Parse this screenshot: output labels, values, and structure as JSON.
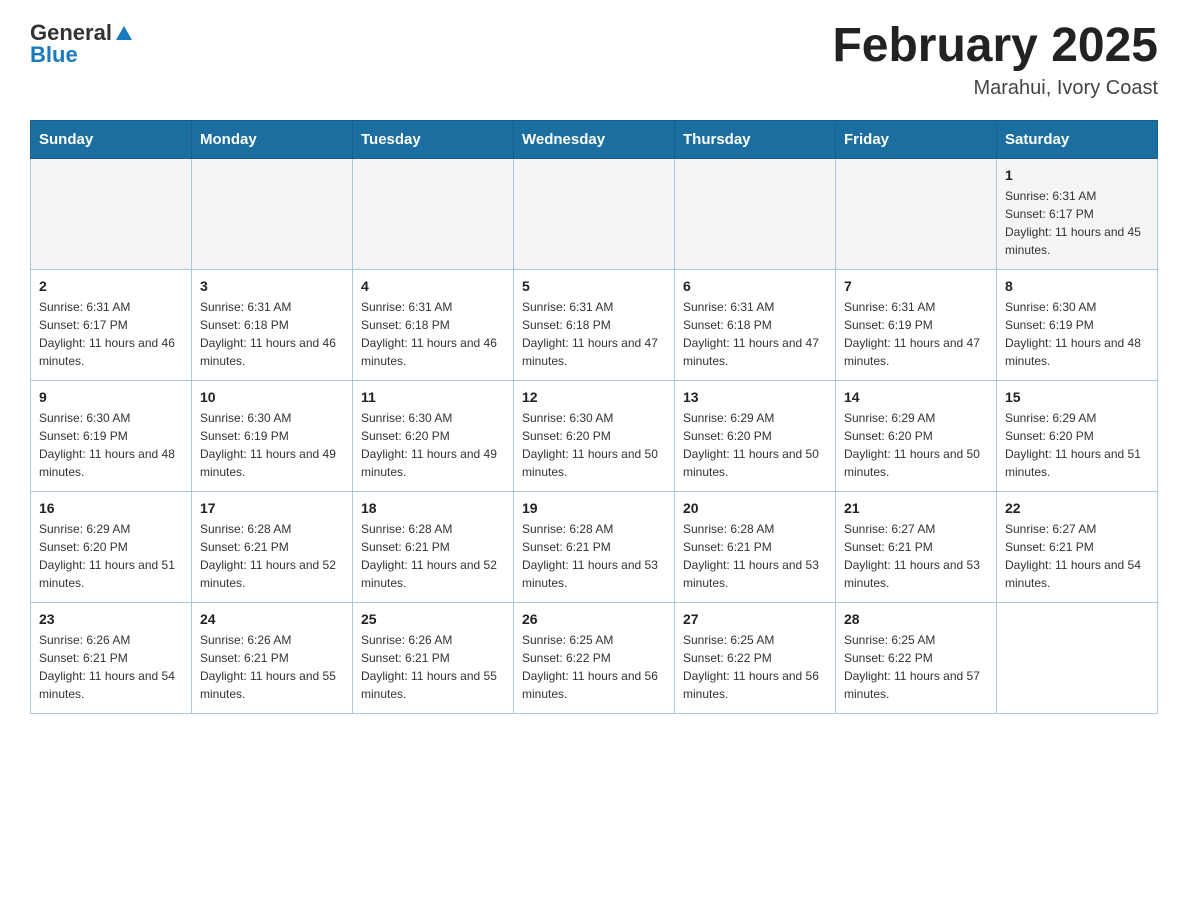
{
  "logo": {
    "general": "General",
    "blue": "Blue"
  },
  "title": "February 2025",
  "location": "Marahui, Ivory Coast",
  "weekdays": [
    "Sunday",
    "Monday",
    "Tuesday",
    "Wednesday",
    "Thursday",
    "Friday",
    "Saturday"
  ],
  "weeks": [
    {
      "days": [
        {
          "num": "",
          "info": ""
        },
        {
          "num": "",
          "info": ""
        },
        {
          "num": "",
          "info": ""
        },
        {
          "num": "",
          "info": ""
        },
        {
          "num": "",
          "info": ""
        },
        {
          "num": "",
          "info": ""
        },
        {
          "num": "1",
          "info": "Sunrise: 6:31 AM\nSunset: 6:17 PM\nDaylight: 11 hours and 45 minutes."
        }
      ]
    },
    {
      "days": [
        {
          "num": "2",
          "info": "Sunrise: 6:31 AM\nSunset: 6:17 PM\nDaylight: 11 hours and 46 minutes."
        },
        {
          "num": "3",
          "info": "Sunrise: 6:31 AM\nSunset: 6:18 PM\nDaylight: 11 hours and 46 minutes."
        },
        {
          "num": "4",
          "info": "Sunrise: 6:31 AM\nSunset: 6:18 PM\nDaylight: 11 hours and 46 minutes."
        },
        {
          "num": "5",
          "info": "Sunrise: 6:31 AM\nSunset: 6:18 PM\nDaylight: 11 hours and 47 minutes."
        },
        {
          "num": "6",
          "info": "Sunrise: 6:31 AM\nSunset: 6:18 PM\nDaylight: 11 hours and 47 minutes."
        },
        {
          "num": "7",
          "info": "Sunrise: 6:31 AM\nSunset: 6:19 PM\nDaylight: 11 hours and 47 minutes."
        },
        {
          "num": "8",
          "info": "Sunrise: 6:30 AM\nSunset: 6:19 PM\nDaylight: 11 hours and 48 minutes."
        }
      ]
    },
    {
      "days": [
        {
          "num": "9",
          "info": "Sunrise: 6:30 AM\nSunset: 6:19 PM\nDaylight: 11 hours and 48 minutes."
        },
        {
          "num": "10",
          "info": "Sunrise: 6:30 AM\nSunset: 6:19 PM\nDaylight: 11 hours and 49 minutes."
        },
        {
          "num": "11",
          "info": "Sunrise: 6:30 AM\nSunset: 6:20 PM\nDaylight: 11 hours and 49 minutes."
        },
        {
          "num": "12",
          "info": "Sunrise: 6:30 AM\nSunset: 6:20 PM\nDaylight: 11 hours and 50 minutes."
        },
        {
          "num": "13",
          "info": "Sunrise: 6:29 AM\nSunset: 6:20 PM\nDaylight: 11 hours and 50 minutes."
        },
        {
          "num": "14",
          "info": "Sunrise: 6:29 AM\nSunset: 6:20 PM\nDaylight: 11 hours and 50 minutes."
        },
        {
          "num": "15",
          "info": "Sunrise: 6:29 AM\nSunset: 6:20 PM\nDaylight: 11 hours and 51 minutes."
        }
      ]
    },
    {
      "days": [
        {
          "num": "16",
          "info": "Sunrise: 6:29 AM\nSunset: 6:20 PM\nDaylight: 11 hours and 51 minutes."
        },
        {
          "num": "17",
          "info": "Sunrise: 6:28 AM\nSunset: 6:21 PM\nDaylight: 11 hours and 52 minutes."
        },
        {
          "num": "18",
          "info": "Sunrise: 6:28 AM\nSunset: 6:21 PM\nDaylight: 11 hours and 52 minutes."
        },
        {
          "num": "19",
          "info": "Sunrise: 6:28 AM\nSunset: 6:21 PM\nDaylight: 11 hours and 53 minutes."
        },
        {
          "num": "20",
          "info": "Sunrise: 6:28 AM\nSunset: 6:21 PM\nDaylight: 11 hours and 53 minutes."
        },
        {
          "num": "21",
          "info": "Sunrise: 6:27 AM\nSunset: 6:21 PM\nDaylight: 11 hours and 53 minutes."
        },
        {
          "num": "22",
          "info": "Sunrise: 6:27 AM\nSunset: 6:21 PM\nDaylight: 11 hours and 54 minutes."
        }
      ]
    },
    {
      "days": [
        {
          "num": "23",
          "info": "Sunrise: 6:26 AM\nSunset: 6:21 PM\nDaylight: 11 hours and 54 minutes."
        },
        {
          "num": "24",
          "info": "Sunrise: 6:26 AM\nSunset: 6:21 PM\nDaylight: 11 hours and 55 minutes."
        },
        {
          "num": "25",
          "info": "Sunrise: 6:26 AM\nSunset: 6:21 PM\nDaylight: 11 hours and 55 minutes."
        },
        {
          "num": "26",
          "info": "Sunrise: 6:25 AM\nSunset: 6:22 PM\nDaylight: 11 hours and 56 minutes."
        },
        {
          "num": "27",
          "info": "Sunrise: 6:25 AM\nSunset: 6:22 PM\nDaylight: 11 hours and 56 minutes."
        },
        {
          "num": "28",
          "info": "Sunrise: 6:25 AM\nSunset: 6:22 PM\nDaylight: 11 hours and 57 minutes."
        },
        {
          "num": "",
          "info": ""
        }
      ]
    }
  ]
}
